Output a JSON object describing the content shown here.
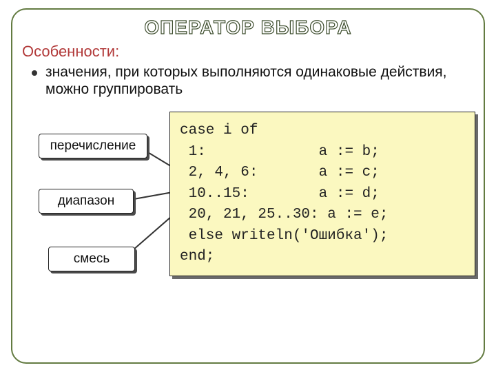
{
  "title": "ОПЕРАТОР ВЫБОРА",
  "subtitle": "Особенности:",
  "bullet": "значения, при которых выполняются одинаковые действия, можно группировать",
  "callouts": {
    "enumeration": "перечисление",
    "range": "диапазон",
    "mix": "смесь"
  },
  "code": {
    "l1": "case i of",
    "l2": " 1:             a := b;",
    "l3": " 2, 4, 6:       a := c;",
    "l4": " 10..15:        a := d;",
    "l5": " 20, 21, 25..30: a := e;",
    "l6": " else writeln('Ошибка');",
    "l7": "end;"
  }
}
